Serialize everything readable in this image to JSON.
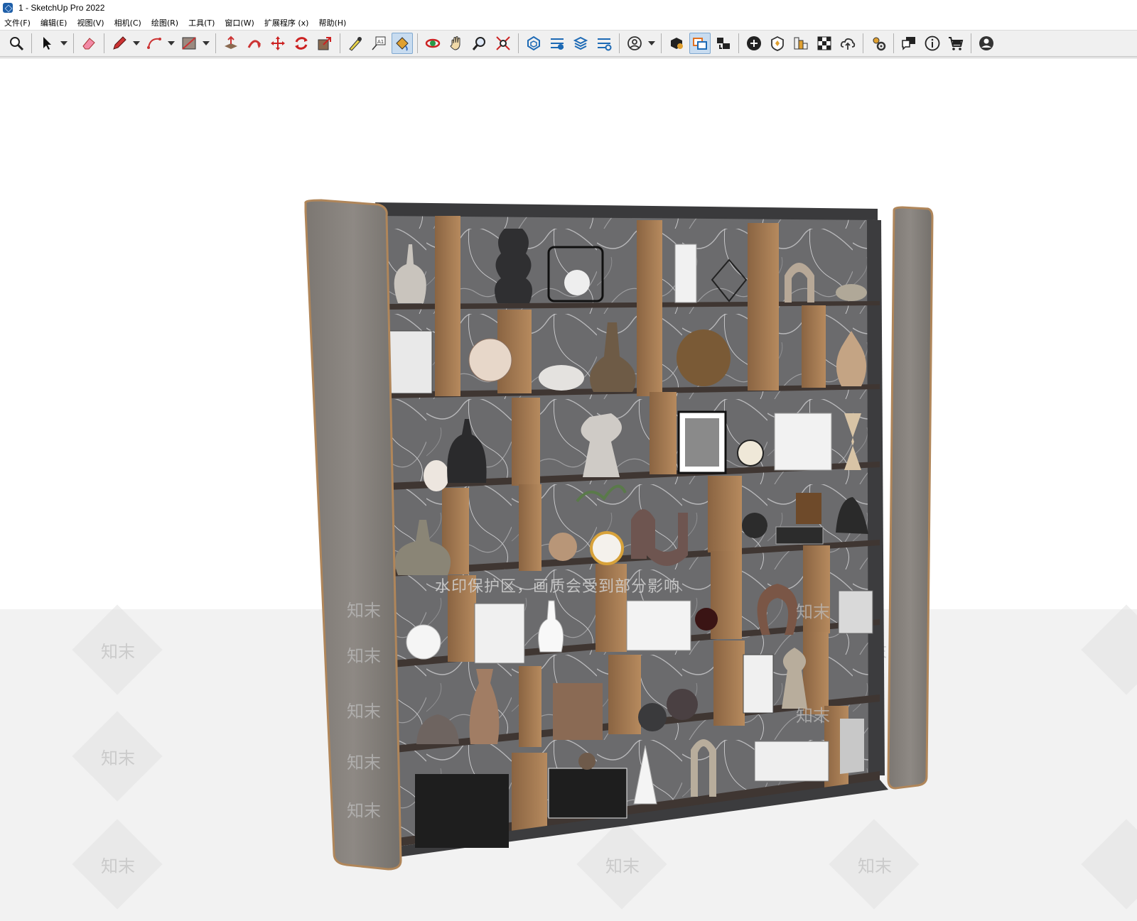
{
  "window": {
    "title": "1 - SketchUp Pro 2022"
  },
  "menu": [
    {
      "label": "文件(F)"
    },
    {
      "label": "编辑(E)"
    },
    {
      "label": "视图(V)"
    },
    {
      "label": "相机(C)"
    },
    {
      "label": "绘图(R)"
    },
    {
      "label": "工具(T)"
    },
    {
      "label": "窗口(W)"
    },
    {
      "label": "扩展程序 (x)"
    },
    {
      "label": "帮助(H)"
    }
  ],
  "toolbar": {
    "tools": [
      "zoom-icon",
      "select-icon",
      "eraser-icon",
      "pencil-icon",
      "arc-icon",
      "rectangle-icon",
      "push-pull-icon",
      "follow-me-icon",
      "move-icon",
      "rotate-icon",
      "scale-icon",
      "tape-measure-icon",
      "text-label-icon",
      "paint-bucket-icon",
      "orbit-icon",
      "pan-icon",
      "zoom-window-icon",
      "zoom-extents-icon",
      "3d-warehouse-icon",
      "extension-warehouse-icon",
      "layout-icon",
      "extension-manager-icon",
      "user-account-icon",
      "component-icon",
      "group-icon",
      "scenes-icon",
      "add-location-icon",
      "solid-tools-icon",
      "sandbox-icon",
      "checker-icon",
      "cloud-upload-icon",
      "settings-icon",
      "chat-icon",
      "info-icon",
      "cart-icon",
      "profile-icon"
    ],
    "active_tools": [
      "paint-bucket-icon",
      "group-icon"
    ]
  },
  "watermark": {
    "brand": "知末",
    "notice": "水印保护区，画质会受到部分影响"
  },
  "colors": {
    "toolbar_bg": "#f0f0f0",
    "active_tool": "#c8dcf0",
    "frame_fabric": "#8a8580",
    "frame_edge": "#b0865a",
    "shelf": "#3f3632",
    "divider_wood": "#a57d55",
    "marble": "#6a6a6c"
  }
}
